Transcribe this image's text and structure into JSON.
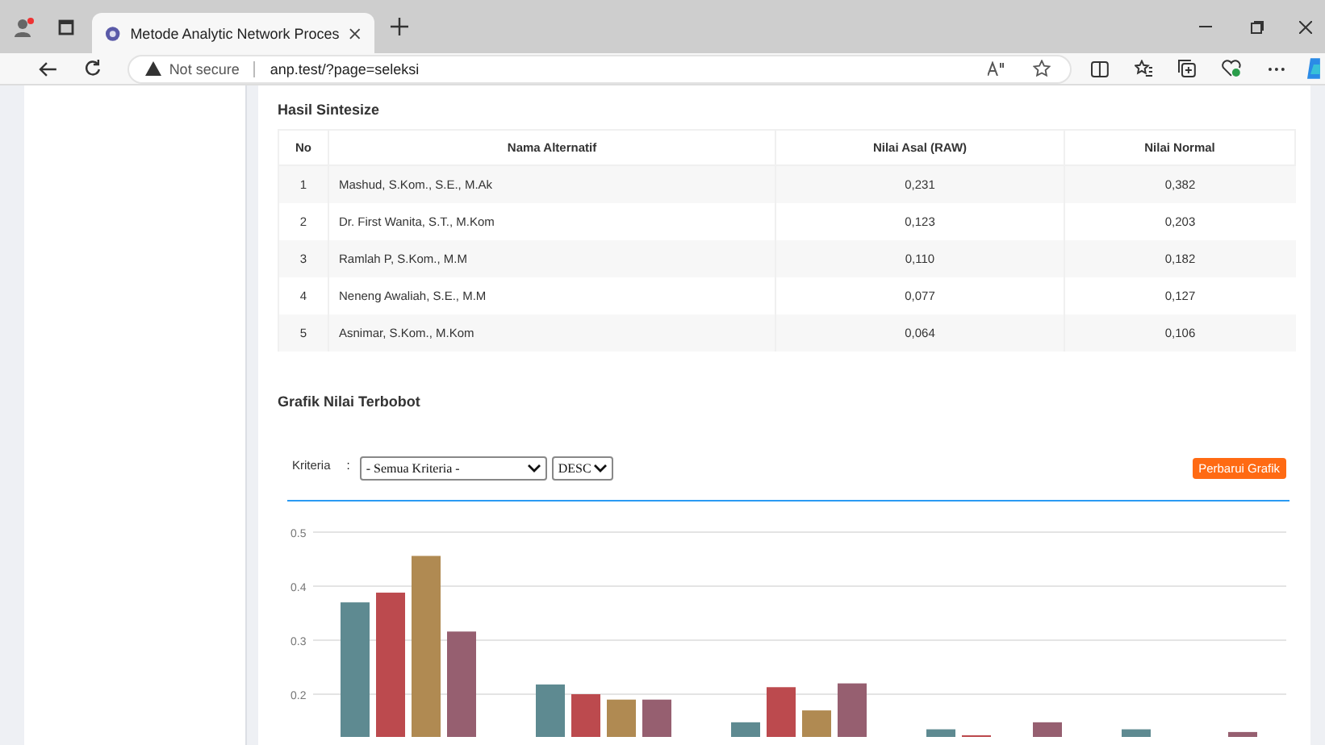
{
  "browser": {
    "tab_title": "Metode Analytic Network Proces",
    "security": "Not secure",
    "url": "anp.test/?page=seleksi"
  },
  "synthesis": {
    "title": "Hasil Sintesize",
    "columns": [
      "No",
      "Nama Alternatif",
      "Nilai Asal (RAW)",
      "Nilai Normal"
    ],
    "rows": [
      [
        "1",
        "Mashud, S.Kom., S.E., M.Ak",
        "0,231",
        "0,382"
      ],
      [
        "2",
        "Dr. First Wanita, S.T., M.Kom",
        "0,123",
        "0,203"
      ],
      [
        "3",
        "Ramlah P, S.Kom., M.M",
        "0,110",
        "0,182"
      ],
      [
        "4",
        "Neneng Awaliah, S.E., M.M",
        "0,077",
        "0,127"
      ],
      [
        "5",
        "Asnimar, S.Kom., M.Kom",
        "0,064",
        "0,106"
      ]
    ]
  },
  "weighted_chart": {
    "title": "Grafik Nilai Terbobot",
    "filter_label": "Kriteria",
    "separator": ":",
    "criteria_select": "- Semua Kriteria -",
    "order_select": "DESC",
    "refresh_button": "Perbarui Grafik",
    "chart_data": {
      "type": "bar",
      "ylim": [
        0.12,
        0.5
      ],
      "grid": true,
      "yticks": [
        0.2,
        0.3,
        0.4,
        0.5
      ],
      "series": [
        {
          "color": "#5e8a91",
          "values": [
            0.37,
            0.218,
            0.148,
            0.135,
            0.135
          ]
        },
        {
          "color": "#bc4a4e",
          "values": [
            0.388,
            0.2,
            0.213,
            0.124,
            null
          ]
        },
        {
          "color": "#b08a52",
          "values": [
            0.456,
            0.19,
            0.17,
            null,
            null
          ]
        },
        {
          "color": "#965f70",
          "values": [
            0.316,
            0.19,
            0.22,
            0.148,
            0.13
          ]
        }
      ]
    }
  }
}
